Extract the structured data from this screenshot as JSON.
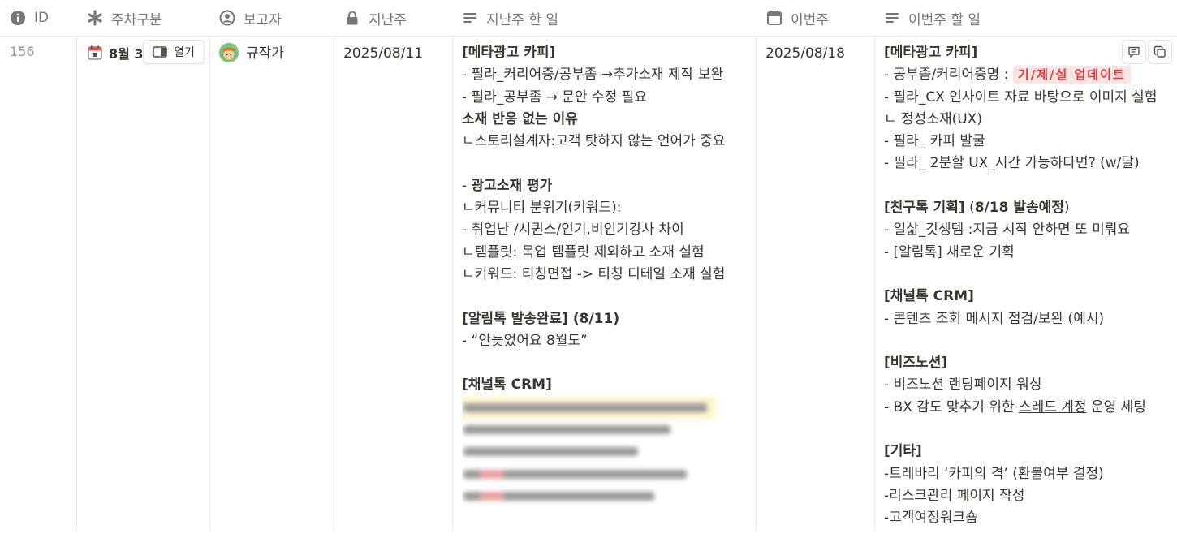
{
  "headers": {
    "id": "ID",
    "week": "주차구분",
    "reporter": "보고자",
    "last_week": "지난주",
    "last_week_done": "지난주 한 일",
    "this_week": "이번주",
    "this_week_todo": "이번주 할 일"
  },
  "row": {
    "id": "156",
    "week_label": "8월 3",
    "open_label": "열기",
    "reporter": "규작가",
    "last_week_date": "2025/08/11",
    "this_week_date": "2025/08/18"
  },
  "last_week_done": {
    "l1": "[메타광고 카피]",
    "l2": "- 필라_커리어증/공부좀 →추가소재 제작 보완",
    "l3": "- 필라_공부좀 → 문안 수정 필요",
    "l4": "소재 반응 없는 이유",
    "l5": "ㄴ스토리설계자:고객 탓하지 않는 언어가 중요",
    "l6a": "- ",
    "l6b": "광고소재 평가",
    "l7": "ㄴ커뮤니티 분위기(키워드):",
    "l8": "- 취업난 /시퀀스/인기,비인기강사 차이",
    "l9": "ㄴ템플릿: 목업 템플릿 제외하고 소재 실험",
    "l10": "ㄴ키워드: 티칭면접 -> 티칭 디테일 소재 실험",
    "l11a": "[알림톡 발송완료]",
    "l11b": " (8/11)",
    "l12": "- “안늦었어요 8월도”",
    "l13": "[채널톡 CRM]"
  },
  "this_week_todo": {
    "l1": "[메타광고 카피]",
    "l2": "- 공부좀/커리어증명 : ",
    "tag": "기/제/설 업데이트",
    "l3": "- 필라_CX 인사이트 자료 바탕으로 이미지 실험",
    "l4": "ㄴ 정성소재(UX)",
    "l5": "- 필라_ 카피 발굴",
    "l6": "- 필라_ 2분할 UX_시간 가능하다면? (w/달)",
    "l7a": "[친구톡 기획]",
    "l7b": " (",
    "l7c": "8/18 발송예정",
    "l7d": ")",
    "l8": "- 일삶_갓생템 :지금 시작 안하면 또 미뤄요",
    "l9": "- [알림톡] 새로운 기획",
    "l10": "[채널톡 CRM]",
    "l11": "- 콘텐츠 조회 메시지 점검/보완 (예시)",
    "l12": "[비즈노션]",
    "l13": "- 비즈노션 랜딩페이지 워싱",
    "l14a": "- BX 감도 맞추기 위한 ",
    "l14b": "스레드 계정",
    "l14c": " 운영 세팅",
    "l15": "[기타]",
    "l16": "-트레바리 ‘카피의 격’ (환불여부 결정)",
    "l17": "-리스크관리 페이지 작성",
    "l18": "-고객여정워크숍"
  }
}
